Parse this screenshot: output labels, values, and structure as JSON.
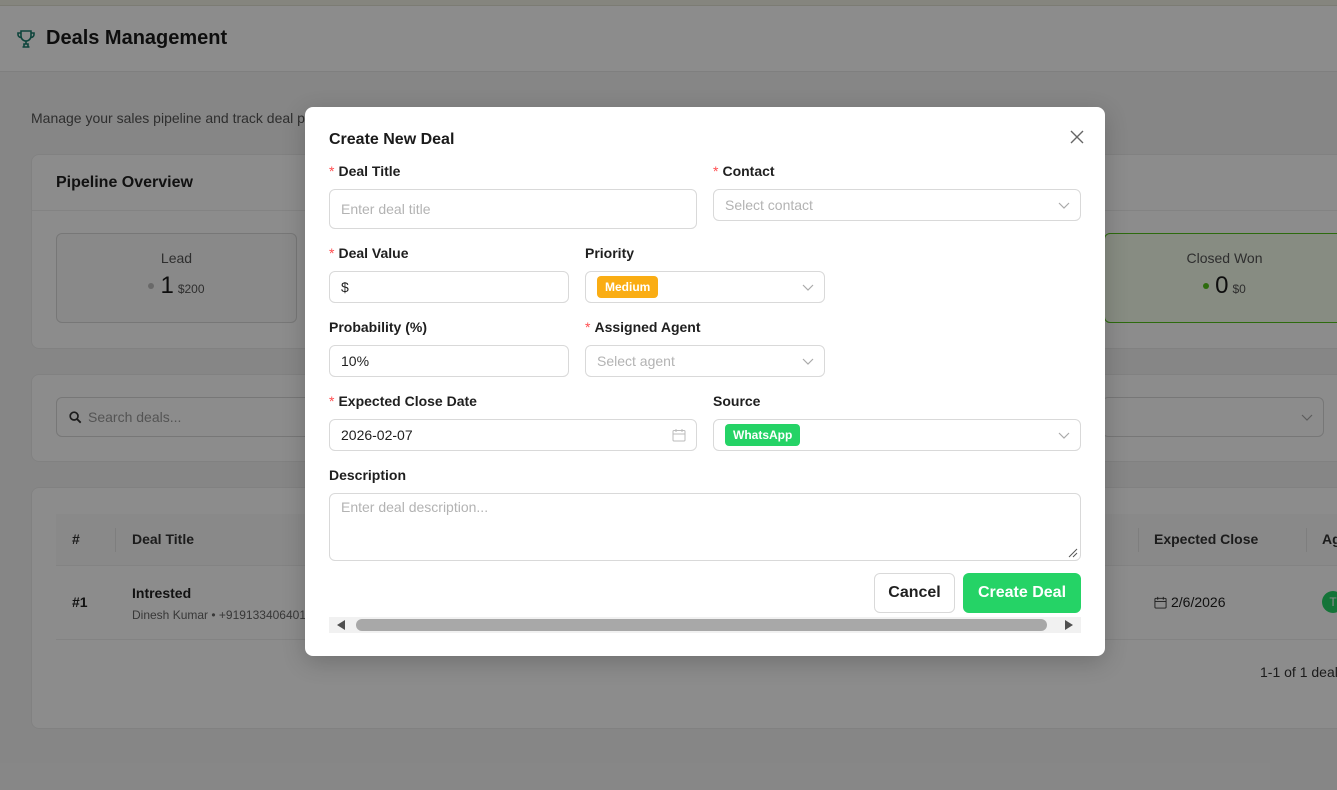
{
  "header": {
    "title": "Deals Management",
    "icon": "trophy-icon"
  },
  "page": {
    "subtitle": "Manage your sales pipeline and track deal pr"
  },
  "pipeline": {
    "title": "Pipeline Overview",
    "stages": [
      {
        "name": "Lead",
        "count": "1",
        "amount": "$200",
        "dot_color": "#bfbfbf"
      },
      {
        "name": "Closed Won",
        "count": "0",
        "amount": "$0",
        "dot_color": "#52c41a"
      }
    ]
  },
  "filters": {
    "search_placeholder": "Search deals..."
  },
  "table": {
    "columns": {
      "num": "#",
      "deal_title": "Deal Title",
      "expected_close": "Expected Close",
      "agent": "Ag"
    },
    "rows": [
      {
        "num": "#1",
        "title": "Intrested",
        "subtitle": "Dinesh Kumar • +919133406401",
        "expected_close": "2/6/2026",
        "agent_initial": "T"
      }
    ],
    "pagination": "1-1 of 1 deal"
  },
  "modal": {
    "title": "Create New Deal",
    "deal_title": {
      "label": "Deal Title",
      "placeholder": "Enter deal title"
    },
    "contact": {
      "label": "Contact",
      "placeholder": "Select contact"
    },
    "deal_value": {
      "label": "Deal Value",
      "prefix": "$"
    },
    "priority": {
      "label": "Priority",
      "value": "Medium",
      "color": "#faad14"
    },
    "probability": {
      "label": "Probability (%)",
      "value": "10%"
    },
    "assigned_agent": {
      "label": "Assigned Agent",
      "placeholder": "Select agent"
    },
    "expected_close": {
      "label": "Expected Close Date",
      "value": "2026-02-07"
    },
    "source": {
      "label": "Source",
      "value": "WhatsApp",
      "color": "#25d366"
    },
    "description": {
      "label": "Description",
      "placeholder": "Enter deal description..."
    },
    "cancel_label": "Cancel",
    "create_label": "Create Deal"
  },
  "colors": {
    "accent_green": "#25d366",
    "required": "#ff4d4f"
  }
}
